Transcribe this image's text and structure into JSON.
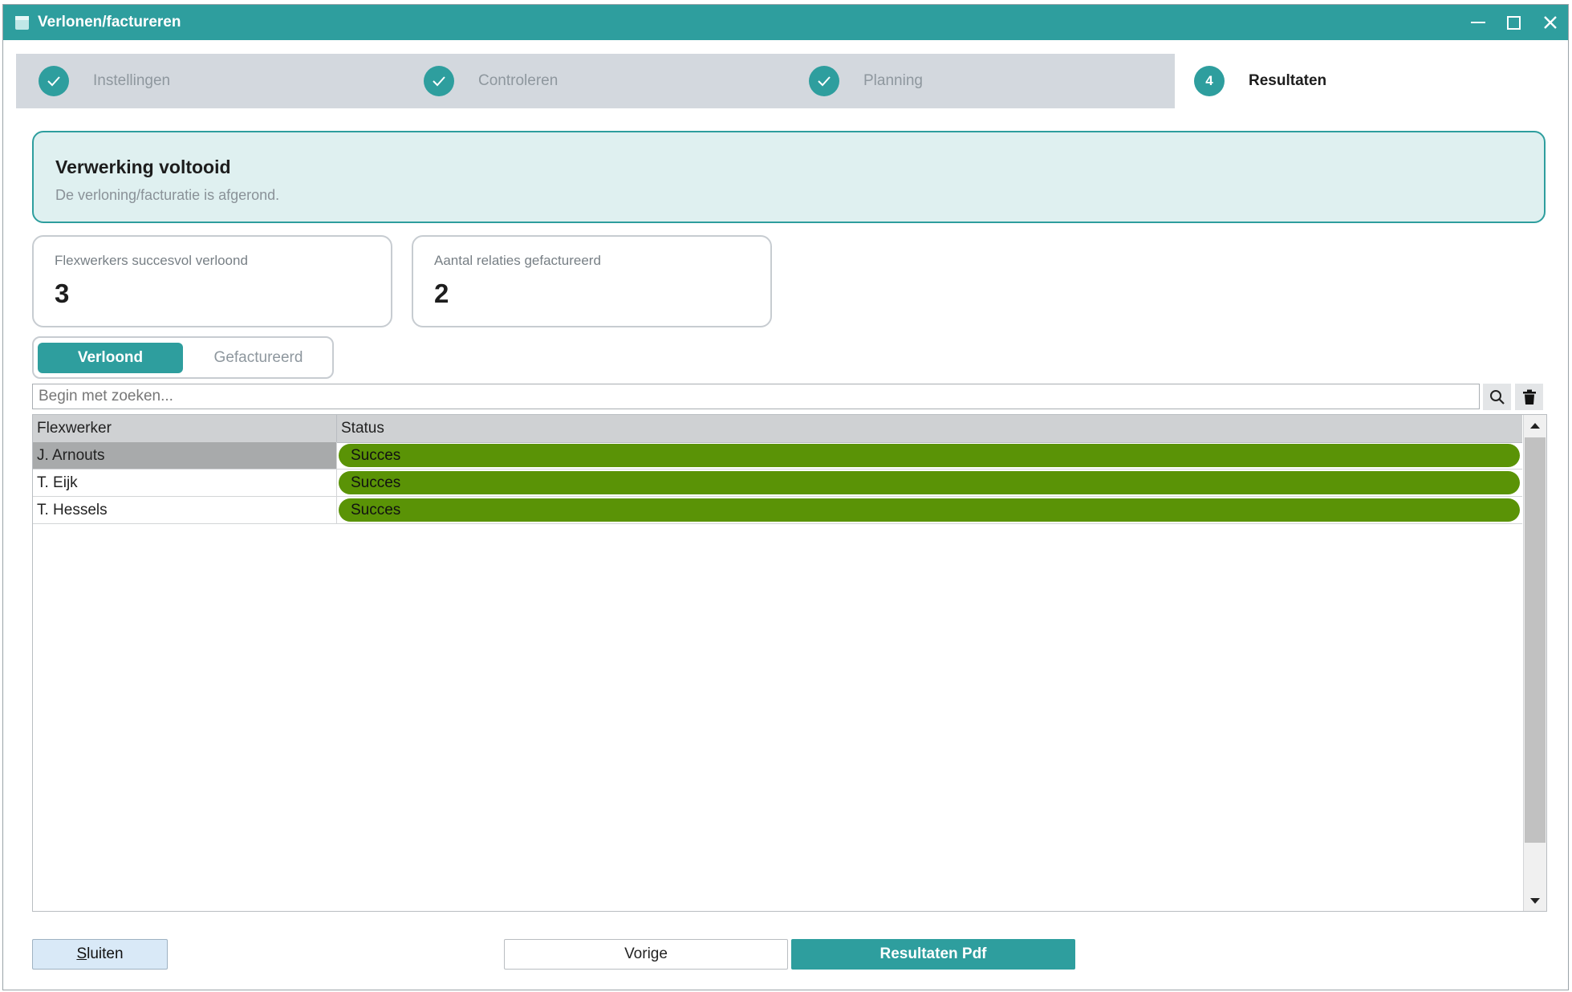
{
  "window": {
    "title": "Verlonen/factureren"
  },
  "steps": [
    {
      "label": "Instellingen",
      "state": "done"
    },
    {
      "label": "Controleren",
      "state": "done"
    },
    {
      "label": "Planning",
      "state": "done"
    },
    {
      "label": "Resultaten",
      "state": "active",
      "number": "4"
    }
  ],
  "banner": {
    "title": "Verwerking voltooid",
    "subtitle": "De verloning/facturatie is afgerond."
  },
  "stats": [
    {
      "label": "Flexwerkers succesvol verloond",
      "value": "3"
    },
    {
      "label": "Aantal relaties gefactureerd",
      "value": "2"
    }
  ],
  "tabs": {
    "active": "Verloond",
    "inactive": "Gefactureerd"
  },
  "search": {
    "placeholder": "Begin met zoeken..."
  },
  "grid": {
    "columns": [
      "Flexwerker",
      "Status"
    ],
    "rows": [
      {
        "name": "J. Arnouts",
        "status": "Succes"
      },
      {
        "name": "T. Eijk",
        "status": "Succes"
      },
      {
        "name": "T. Hessels",
        "status": "Succes"
      }
    ]
  },
  "buttons": {
    "close_prefix": "S",
    "close_rest": "luiten",
    "prev": "Vorige",
    "pdf": "Resultaten Pdf"
  },
  "colors": {
    "accent": "#2e9e9e",
    "success": "#5a9306",
    "banner_bg": "#dff0f0"
  }
}
